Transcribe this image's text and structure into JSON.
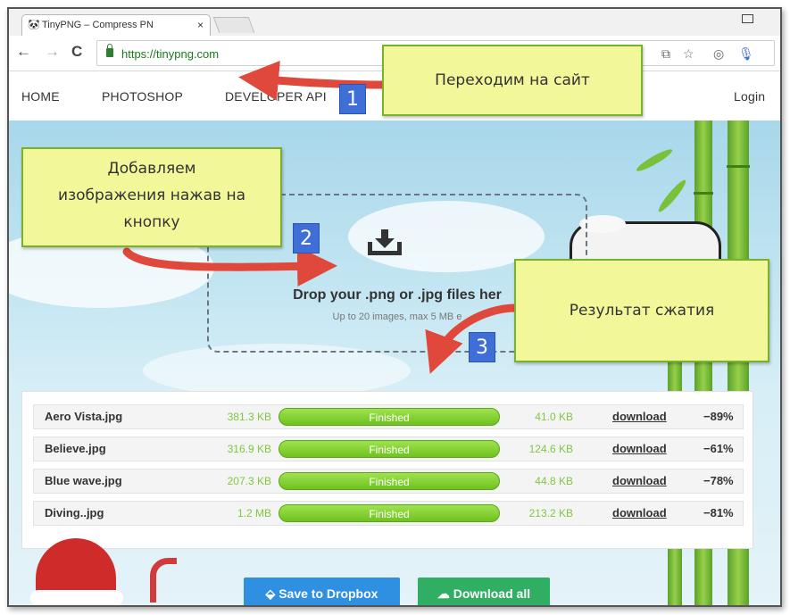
{
  "browser": {
    "tab_title": "TinyPNG – Compress PN",
    "tab_close": "×",
    "url": "https://tinypng.com",
    "back": "←",
    "forward": "→",
    "reload": "C"
  },
  "site_nav": {
    "items": [
      "HOME",
      "PHOTOSHOP",
      "DEVELOPER API"
    ],
    "login": "Login"
  },
  "dropzone": {
    "title": "Drop your .png or .jpg files her",
    "subtitle": "Up to 20 images, max 5 MB e"
  },
  "results": [
    {
      "name": "Aero Vista.jpg",
      "original": "381.3 KB",
      "status": "Finished",
      "compressed": "41.0 KB",
      "action": "download",
      "saving": "−89%"
    },
    {
      "name": "Believe.jpg",
      "original": "316.9 KB",
      "status": "Finished",
      "compressed": "124.6 KB",
      "action": "download",
      "saving": "−61%"
    },
    {
      "name": "Blue wave.jpg",
      "original": "207.3 KB",
      "status": "Finished",
      "compressed": "44.8 KB",
      "action": "download",
      "saving": "−78%"
    },
    {
      "name": "Diving..jpg",
      "original": "1.2 MB",
      "status": "Finished",
      "compressed": "213.2 KB",
      "action": "download",
      "saving": "−81%"
    }
  ],
  "progress_fill": [
    1,
    1,
    1,
    1
  ],
  "buttons": {
    "dropbox": "Save to Dropbox",
    "download_all": "Download all"
  },
  "annotations": {
    "step1": {
      "number": "1",
      "text": "Переходим на сайт"
    },
    "step2": {
      "number": "2",
      "lines": [
        "Добавляем",
        "изображения нажав на",
        "кнопку"
      ]
    },
    "step3": {
      "number": "3",
      "text": "Результат сжатия"
    }
  },
  "colors": {
    "accent_green": "#7fc83f",
    "callout_bg": "#f2f79a",
    "badge_blue": "#3f6fd6",
    "arrow_red": "#e0483c",
    "dropbox_blue": "#2f8fe0",
    "download_all_green": "#2fae64"
  }
}
